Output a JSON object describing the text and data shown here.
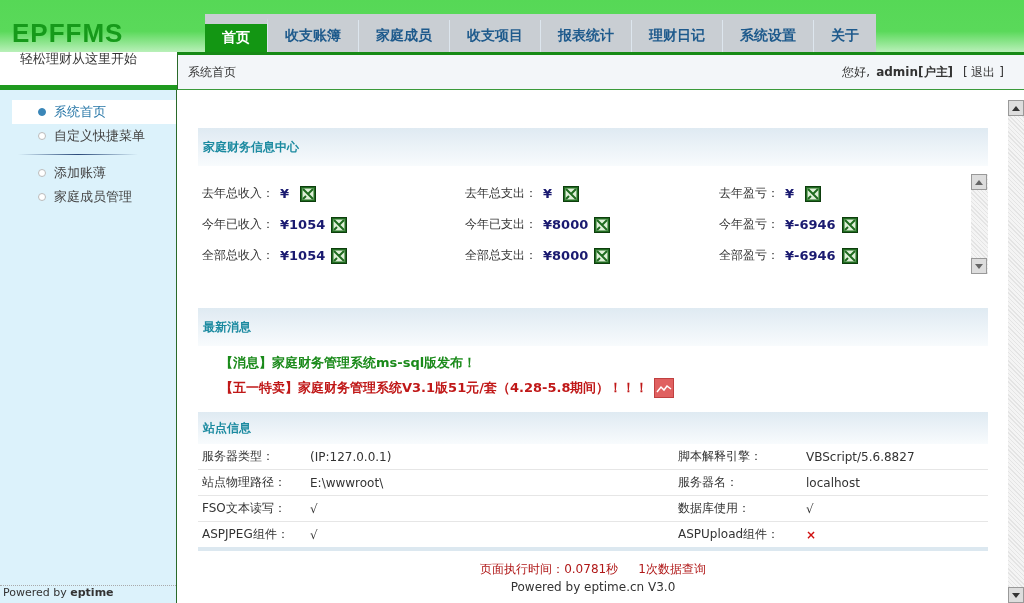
{
  "header": {
    "logo": "EPFFMS",
    "slogan": "轻松理财从这里开始"
  },
  "tabs": [
    {
      "label": "首页",
      "selected": true
    },
    {
      "label": "收支账簿",
      "selected": false
    },
    {
      "label": "家庭成员",
      "selected": false
    },
    {
      "label": "收支项目",
      "selected": false
    },
    {
      "label": "报表统计",
      "selected": false
    },
    {
      "label": "理财日记",
      "selected": false
    },
    {
      "label": "系统设置",
      "selected": false
    },
    {
      "label": "关于",
      "selected": false
    }
  ],
  "breadcrumb": "系统首页",
  "user": {
    "greeting": "您好,",
    "name": "admin[户主]",
    "logout": "[ 退出 ]"
  },
  "sidebar": {
    "items": [
      {
        "label": "系统首页",
        "selected": true
      },
      {
        "label": "自定义快捷菜单",
        "selected": false
      },
      {
        "label": "添加账薄",
        "selected": false
      },
      {
        "label": "家庭成员管理",
        "selected": false
      }
    ],
    "footer": "Powered by **eptime**"
  },
  "finance": {
    "title": "家庭财务信息中心",
    "rows": [
      [
        {
          "label": "去年总收入：",
          "value": "¥"
        },
        {
          "label": "去年总支出：",
          "value": "¥"
        },
        {
          "label": "去年盈亏：",
          "value": "¥"
        }
      ],
      [
        {
          "label": "今年已收入：",
          "value": "¥1054"
        },
        {
          "label": "今年已支出：",
          "value": "¥8000"
        },
        {
          "label": "今年盈亏：",
          "value": "¥-6946"
        }
      ],
      [
        {
          "label": "全部总收入：",
          "value": "¥1054"
        },
        {
          "label": "全部总支出：",
          "value": "¥8000"
        },
        {
          "label": "全部盈亏：",
          "value": "¥-6946"
        }
      ]
    ]
  },
  "news": {
    "title": "最新消息",
    "items": [
      {
        "text": "【消息】家庭财务管理系统ms-sql版发布！",
        "color": "#1a8a1a",
        "icon": false
      },
      {
        "text": "【五一特卖】家庭财务管理系统V3.1版51元/套（4.28-5.8期间）！！！",
        "color": "#c01818",
        "icon": true
      }
    ]
  },
  "site_info": {
    "title": "站点信息",
    "rows": [
      [
        {
          "text": "服务器类型：",
          "kind": "label"
        },
        {
          "text": "(IP:127.0.0.1)",
          "kind": "text"
        },
        {
          "text": "脚本解释引擎：",
          "kind": "label"
        },
        {
          "text": "VBScript/5.6.8827",
          "kind": "text"
        }
      ],
      [
        {
          "text": "站点物理路径：",
          "kind": "label"
        },
        {
          "text": "E:\\wwwroot\\",
          "kind": "text"
        },
        {
          "text": "服务器名：",
          "kind": "label"
        },
        {
          "text": "localhost",
          "kind": "text"
        }
      ],
      [
        {
          "text": "FSO文本读写：",
          "kind": "label"
        },
        {
          "text": "√",
          "kind": "check"
        },
        {
          "text": "数据库使用：",
          "kind": "label"
        },
        {
          "text": "√",
          "kind": "check"
        }
      ],
      [
        {
          "text": "ASPJPEG组件：",
          "kind": "label"
        },
        {
          "text": "√",
          "kind": "check"
        },
        {
          "text": "ASPUpload组件：",
          "kind": "label"
        },
        {
          "text": "×",
          "kind": "cross"
        }
      ]
    ]
  },
  "footer": {
    "time": "页面执行时间：0.0781秒",
    "queries": "1次数据查询",
    "powered": "Powered by eptime.cn V3.0"
  }
}
